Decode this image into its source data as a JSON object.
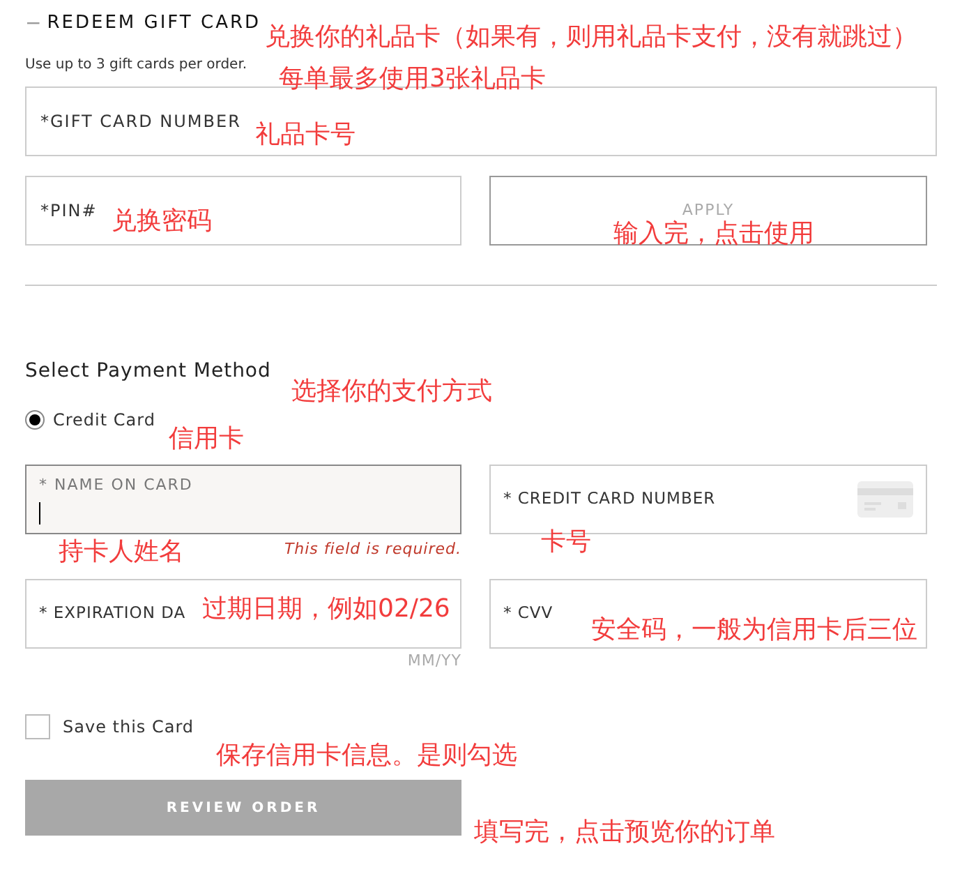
{
  "gift_card": {
    "toggle": "−",
    "title": "REDEEM GIFT CARD",
    "note": "Use up to 3 gift cards per order.",
    "number_field": {
      "label": "*GIFT CARD NUMBER"
    },
    "pin_field": {
      "label": "*PIN#"
    },
    "apply_button": "APPLY"
  },
  "payment": {
    "title": "Select Payment Method",
    "methods": [
      {
        "label": "Credit Card",
        "selected": true
      }
    ],
    "fields": [
      {
        "label": "* NAME ON CARD",
        "focused": true,
        "error": "This field is required."
      },
      {
        "label": "* CREDIT CARD NUMBER",
        "focused": false
      },
      {
        "label": "* EXPIRATION DA",
        "focused": false,
        "hint": "MM/YY"
      },
      {
        "label": "* CVV",
        "focused": false
      }
    ],
    "save_card": {
      "label": "Save this Card",
      "checked": false
    },
    "review_button": "REVIEW ORDER"
  },
  "annotations": [
    {
      "text": "兑换你的礼品卡（如果有，则用礼品卡支付，没有就跳过）"
    },
    {
      "text": "每单最多使用3张礼品卡"
    },
    {
      "text": "礼品卡号"
    },
    {
      "text": "兑换密码"
    },
    {
      "text": "输入完，点击使用"
    },
    {
      "text": "选择你的支付方式"
    },
    {
      "text": "信用卡"
    },
    {
      "text": "持卡人姓名"
    },
    {
      "text": "卡号"
    },
    {
      "text": "过期日期，例如02/26"
    },
    {
      "text": "安全码，一般为信用卡后三位"
    },
    {
      "text": "保存信用卡信息。是则勾选"
    },
    {
      "text": "填写完，点击预览你的订单"
    }
  ]
}
